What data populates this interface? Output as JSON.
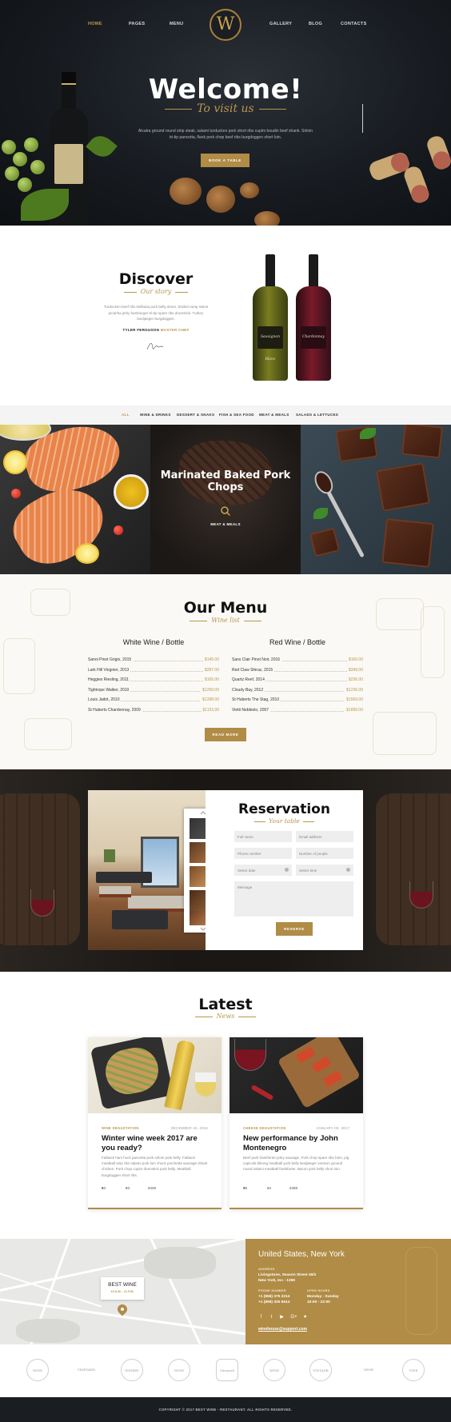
{
  "nav": {
    "items": [
      {
        "label": "HOME",
        "active": true
      },
      {
        "label": "PAGES"
      },
      {
        "label": "MENU"
      },
      {
        "label": "GALLERY"
      },
      {
        "label": "BLOG"
      },
      {
        "label": "CONTACTS"
      }
    ],
    "logo_letter": "W"
  },
  "hero": {
    "title": "Welcome!",
    "subtitle": "To visit us",
    "text": "Alcatra ground round strip steak, salami turducken pork short ribs cupim boudin beef shank. Sirloin tri-tip pancetta, flank pork chop beef ribs burgdoggen short loin.",
    "button": "BOOK A TABLE"
  },
  "discover": {
    "title": "Discover",
    "subtitle": "Our story",
    "text": "Turducken beef ribs kielbasa pork belly doner, brisket rump swine picanha jerky hamburger tri-tip spare ribs drumstick. Turkey landjaeger burgdoggen.",
    "author_name": "TYLER FERGUSON",
    "author_role": "MASTER CHEF",
    "bottle_labels": [
      "Sauvignon Blanc",
      "Chardonnay"
    ]
  },
  "filters": [
    {
      "label": "ALL",
      "active": true
    },
    {
      "label": "WINE & DRINKS"
    },
    {
      "label": "DESSERT & SNAKS"
    },
    {
      "label": "FISH & SEA FOOD"
    },
    {
      "label": "MEAT & MEALS"
    },
    {
      "label": "SALADS & LETTUCES"
    }
  ],
  "gallery": {
    "featured_title": "Marinated Baked Pork Chops",
    "featured_category": "MEAT & MEALS"
  },
  "menu": {
    "title": "Our Menu",
    "subtitle": "Wine list",
    "columns": [
      {
        "heading": "White Wine / Bottle",
        "items": [
          {
            "name": "Sanoi Pinot Grigio, 2015",
            "price": "$145.00"
          },
          {
            "name": "Lark Hill Viognier, 2013",
            "price": "$287.00"
          },
          {
            "name": "Heggies Riesling, 2011",
            "price": "$165.00"
          },
          {
            "name": "Tightrope Walker, 2010",
            "price": "$1259.00"
          },
          {
            "name": "Louis Jadot, 2010",
            "price": "$1398.00"
          },
          {
            "name": "St Huberts Chardonnay, 2009",
            "price": "$1123.00"
          }
        ]
      },
      {
        "heading": "Red Wine / Bottle",
        "items": [
          {
            "name": "Sans Clair Pinot Noir, 2016",
            "price": "$160.00"
          },
          {
            "name": "Red Claw Shiraz, 2015",
            "price": "$349.00"
          },
          {
            "name": "Quartz Reef, 2014",
            "price": "$236.00"
          },
          {
            "name": "Cloudy Bay, 2012",
            "price": "$1236.00"
          },
          {
            "name": "St Huberts The Stag, 2010",
            "price": "$1569.00"
          },
          {
            "name": "Vietti Nebbiolo, 2007",
            "price": "$1899.00"
          }
        ]
      }
    ],
    "button": "READ MORE"
  },
  "reservation": {
    "title": "Reservation",
    "subtitle": "Your table",
    "fields": {
      "full_name": "Full name",
      "email": "Email address",
      "phone": "Phone number",
      "people": "Number of people",
      "date": "Select date",
      "time": "Select time",
      "message": "Message"
    },
    "button": "RESERVE"
  },
  "latest": {
    "title": "Latest",
    "subtitle": "News",
    "posts": [
      {
        "category": "WINE DEGUSTATION",
        "date": "DECEMBER 15, 2016",
        "title": "Winter wine week 2017 are you ready?",
        "excerpt": "Fatback ham hock pancetta pork sirloin pork belly. Fatback meatball strip ribs salami pork loin chuck porchetta sausage shank chicken. Pork chop cupim drumstick pork belly. Meatball burgdoggen short ribs.",
        "likes": "63",
        "comments": "93",
        "views": "3408"
      },
      {
        "category": "CHEESE DEGUSTATION",
        "date": "JANUARY 08, 2017",
        "title": "New performance by John Montenegro",
        "excerpt": "Beef pork frankfurter jerky sausage. Pork chop spare ribs ham, pig capicola biltong meatball pork belly landjaeger venison ground round salami meatball frankfurter. Bacon pork belly short loin.",
        "likes": "58",
        "comments": "34",
        "views": "2389"
      }
    ]
  },
  "map": {
    "card_title": "BEST WINE",
    "card_hours": "10 A.M. - 11 P.M."
  },
  "contact": {
    "title": "United States, New York",
    "address_label": "ADDRESS",
    "address": [
      "Livingstone, Season Street 45/2",
      "New York, Inc - 1269"
    ],
    "phone_label": "PHONE NUMBER",
    "phones": [
      "+1 (866) 375 2214",
      "+1 (869) 325 6614"
    ],
    "hours_label": "OPEN HOURS",
    "hours": [
      "Monday - Sunday",
      "10:00 - 22:00"
    ],
    "social": [
      "f",
      "t",
      "▶",
      "G+",
      "♥"
    ],
    "email": "winehouse@support.com"
  },
  "brands": [
    "WINE",
    "VINEYARD",
    "WINERY",
    "WINE",
    "Vineyard",
    "WINE",
    "VINTAGE",
    "WINE",
    "VINE"
  ],
  "footer": {
    "copyright": "COPYRIGHT © 2017 BEST WINE - RESTAURANT. ALL RIGHTS RESERVED."
  },
  "colors": {
    "accent": "#b08c46",
    "dark": "#1a1d22"
  }
}
